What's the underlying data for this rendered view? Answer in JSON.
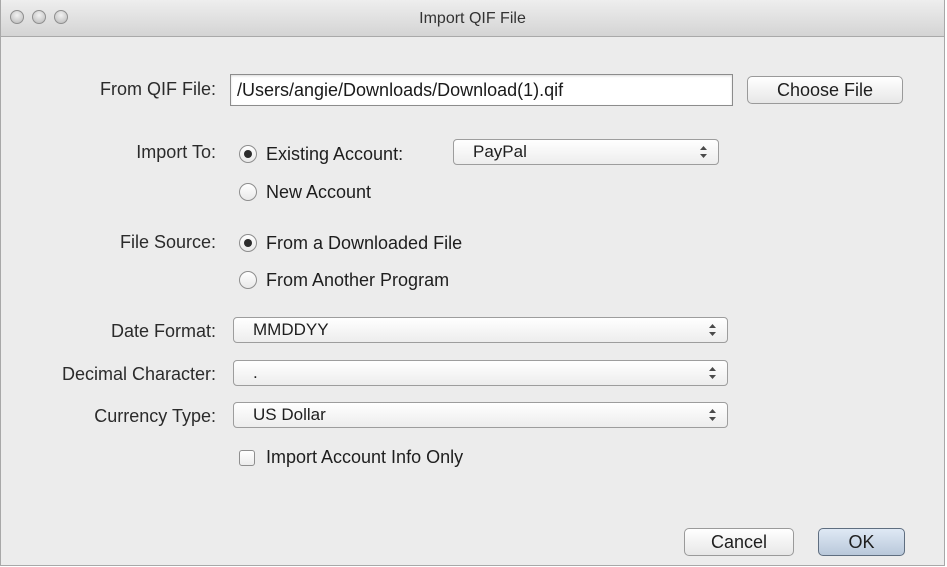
{
  "window": {
    "title": "Import QIF File"
  },
  "form": {
    "from_qif_file": {
      "label": "From QIF File:",
      "value": "/Users/angie/Downloads/Download(1).qif",
      "choose_button": "Choose File"
    },
    "import_to": {
      "label": "Import To:",
      "options": [
        {
          "label": "Existing Account:",
          "selected": true
        },
        {
          "label": "New Account",
          "selected": false
        }
      ],
      "account_popup_value": "PayPal"
    },
    "file_source": {
      "label": "File Source:",
      "options": [
        {
          "label": "From a Downloaded File",
          "selected": true
        },
        {
          "label": "From Another Program",
          "selected": false
        }
      ]
    },
    "date_format": {
      "label": "Date Format:",
      "value": "MMDDYY"
    },
    "decimal_character": {
      "label": "Decimal Character:",
      "value": "."
    },
    "currency_type": {
      "label": "Currency Type:",
      "value": "US Dollar"
    },
    "import_account_info_only": {
      "label": "Import Account Info Only",
      "checked": false
    }
  },
  "buttons": {
    "cancel": "Cancel",
    "ok": "OK"
  }
}
